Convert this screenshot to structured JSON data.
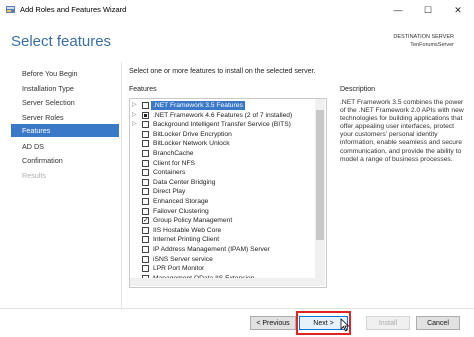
{
  "window": {
    "title": "Add Roles and Features Wizard",
    "min_glyph": "—",
    "max_glyph": "☐",
    "close_glyph": "✕"
  },
  "header": {
    "title": "Select features",
    "destination_label": "DESTINATION SERVER",
    "destination_value": "TenForumsServer"
  },
  "nav": {
    "items": [
      {
        "label": "Before You Begin",
        "state": "normal"
      },
      {
        "label": "Installation Type",
        "state": "normal"
      },
      {
        "label": "Server Selection",
        "state": "normal"
      },
      {
        "label": "Server Roles",
        "state": "normal"
      },
      {
        "label": "Features",
        "state": "active"
      },
      {
        "label": "AD DS",
        "state": "normal"
      },
      {
        "label": "Confirmation",
        "state": "normal"
      },
      {
        "label": "Results",
        "state": "disabled"
      }
    ]
  },
  "main": {
    "instruction": "Select one or more features to install on the selected server.",
    "features_heading": "Features",
    "description_heading": "Description",
    "description": ".NET Framework 3.5 combines the power of the .NET Framework 2.0 APIs with new technologies for building applications that offer appealing user interfaces, protect your customers' personal identity information, enable seamless and secure communication, and provide the ability to model a range of business processes.",
    "features": [
      {
        "label": ".NET Framework 3.5 Features",
        "expandable": true,
        "state": "unchecked",
        "selected": true
      },
      {
        "label": ".NET Framework 4.6 Features (2 of 7 installed)",
        "expandable": true,
        "state": "partial",
        "selected": false
      },
      {
        "label": "Background Intelligent Transfer Service (BITS)",
        "expandable": true,
        "state": "unchecked",
        "selected": false
      },
      {
        "label": "BitLocker Drive Encryption",
        "expandable": false,
        "state": "unchecked",
        "selected": false
      },
      {
        "label": "BitLocker Network Unlock",
        "expandable": false,
        "state": "unchecked",
        "selected": false
      },
      {
        "label": "BranchCache",
        "expandable": false,
        "state": "unchecked",
        "selected": false
      },
      {
        "label": "Client for NFS",
        "expandable": false,
        "state": "unchecked",
        "selected": false
      },
      {
        "label": "Containers",
        "expandable": false,
        "state": "unchecked",
        "selected": false
      },
      {
        "label": "Data Center Bridging",
        "expandable": false,
        "state": "unchecked",
        "selected": false
      },
      {
        "label": "Direct Play",
        "expandable": false,
        "state": "unchecked",
        "selected": false
      },
      {
        "label": "Enhanced Storage",
        "expandable": false,
        "state": "unchecked",
        "selected": false
      },
      {
        "label": "Failover Clustering",
        "expandable": false,
        "state": "unchecked",
        "selected": false
      },
      {
        "label": "Group Policy Management",
        "expandable": false,
        "state": "checked",
        "selected": false
      },
      {
        "label": "IIS Hostable Web Core",
        "expandable": false,
        "state": "unchecked",
        "selected": false
      },
      {
        "label": "Internet Printing Client",
        "expandable": false,
        "state": "unchecked",
        "selected": false
      },
      {
        "label": "IP Address Management (IPAM) Server",
        "expandable": false,
        "state": "unchecked",
        "selected": false
      },
      {
        "label": "iSNS Server service",
        "expandable": false,
        "state": "unchecked",
        "selected": false
      },
      {
        "label": "LPR Port Monitor",
        "expandable": false,
        "state": "unchecked",
        "selected": false
      },
      {
        "label": "Management OData IIS Extension",
        "expandable": false,
        "state": "unchecked",
        "selected": false
      }
    ]
  },
  "buttons": {
    "previous": "< Previous",
    "next": "Next >",
    "install": "Install",
    "cancel": "Cancel"
  },
  "colors": {
    "accent": "#3a78c8",
    "highlight_box": "#e02424",
    "title_text": "#3a6ea5"
  }
}
